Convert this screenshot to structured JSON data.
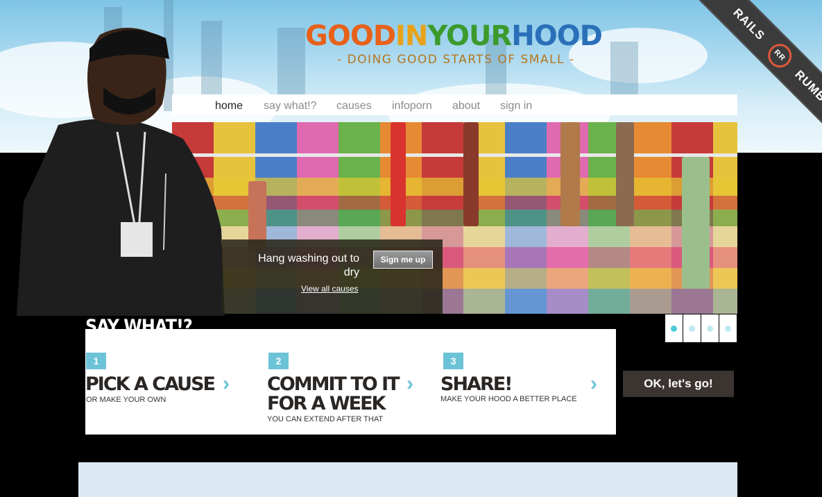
{
  "header": {
    "logo_parts": [
      "GOOD",
      "IN",
      "YOUR",
      "HOOD"
    ],
    "tagline": "- DOING GOOD STARTS OF SMALL -"
  },
  "nav": {
    "items": [
      {
        "label": "home",
        "active": true
      },
      {
        "label": "say what!?",
        "active": false
      },
      {
        "label": "causes",
        "active": false
      },
      {
        "label": "infoporn",
        "active": false
      },
      {
        "label": "about",
        "active": false
      },
      {
        "label": "sign in",
        "active": false
      }
    ]
  },
  "ribbon": {
    "left": "RAILS",
    "right": "RUMBLE",
    "badge": "RR"
  },
  "hero": {
    "cause_text": "Hang washing out to dry",
    "signup_label": "Sign me up",
    "view_all_label": "View all causes",
    "slides": 4,
    "active_slide": 1
  },
  "say_what": {
    "title": "SAY WHAT!?",
    "steps": [
      {
        "number": "1",
        "title": "PICK A CAUSE",
        "subtitle": "OR MAKE YOUR OWN"
      },
      {
        "number": "2",
        "title": "COMMIT TO IT FOR A WEEK",
        "subtitle": "YOU CAN EXTEND AFTER THAT"
      },
      {
        "number": "3",
        "title": "SHARE!",
        "subtitle": "MAKE YOUR HOOD A BETTER PLACE"
      }
    ],
    "cta_label": "OK, let's go!"
  },
  "colors": {
    "accent": "#6cc3d8",
    "dark_button": "#3b3430",
    "bottom_panel": "#dde9f2"
  }
}
